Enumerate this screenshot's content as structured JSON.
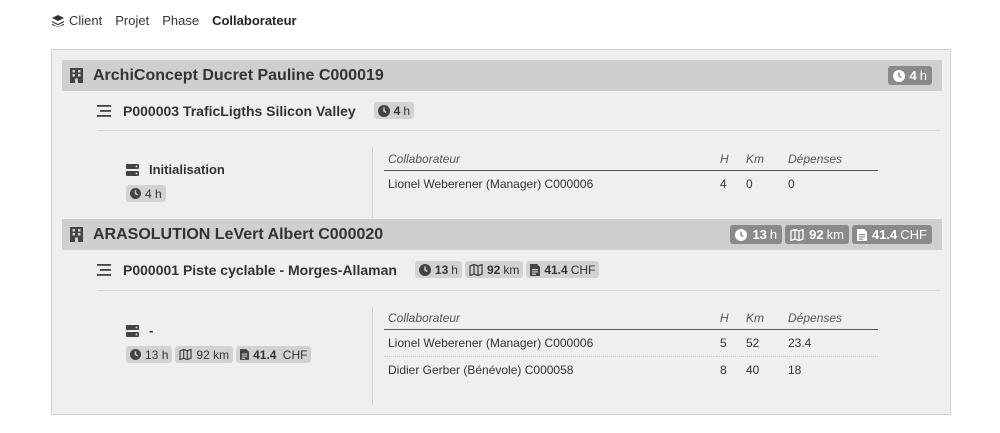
{
  "breadcrumb": {
    "items": [
      {
        "label": "Client",
        "active": false
      },
      {
        "label": "Projet",
        "active": false
      },
      {
        "label": "Phase",
        "active": false
      },
      {
        "label": "Collaborateur",
        "active": true
      }
    ]
  },
  "columns": {
    "collaborateur": "Collaborateur",
    "h": "H",
    "km": "Km",
    "depenses": "Dépenses"
  },
  "units": {
    "hours": "h",
    "km": "km",
    "currency": "CHF"
  },
  "clients": [
    {
      "title": "ArchiConcept Ducret Pauline C000019",
      "hours": "4",
      "projects": [
        {
          "title": "P000003 TraficLigths Silicon Valley",
          "hours": "4",
          "phases": [
            {
              "name": "Initialisation",
              "hours": "4",
              "collaborators": [
                {
                  "name": "Lionel Weberener (Manager) C000006",
                  "h": "4",
                  "km": "0",
                  "depenses": "0"
                }
              ]
            }
          ]
        }
      ]
    },
    {
      "title": "ARASOLUTION LeVert Albert C000020",
      "hours": "13",
      "km": "92",
      "expenses": "41.4",
      "projects": [
        {
          "title": "P000001 Piste cyclable - Morges-Allaman",
          "hours": "13",
          "km": "92",
          "expenses": "41.4",
          "phases": [
            {
              "name": "-",
              "hours": "13",
              "km": "92",
              "expenses": "41.4",
              "collaborators": [
                {
                  "name": "Lionel Weberener (Manager) C000006",
                  "h": "5",
                  "km": "52",
                  "depenses": "23.4"
                },
                {
                  "name": "Didier Gerber (Bénévole) C000058",
                  "h": "8",
                  "km": "40",
                  "depenses": "18"
                }
              ]
            }
          ]
        }
      ]
    }
  ],
  "colors": {
    "client_bar": "#cfcfcf",
    "badge_dark": "#8a8a8a",
    "badge_light": "#d2d2d2",
    "panel": "#efefef"
  }
}
